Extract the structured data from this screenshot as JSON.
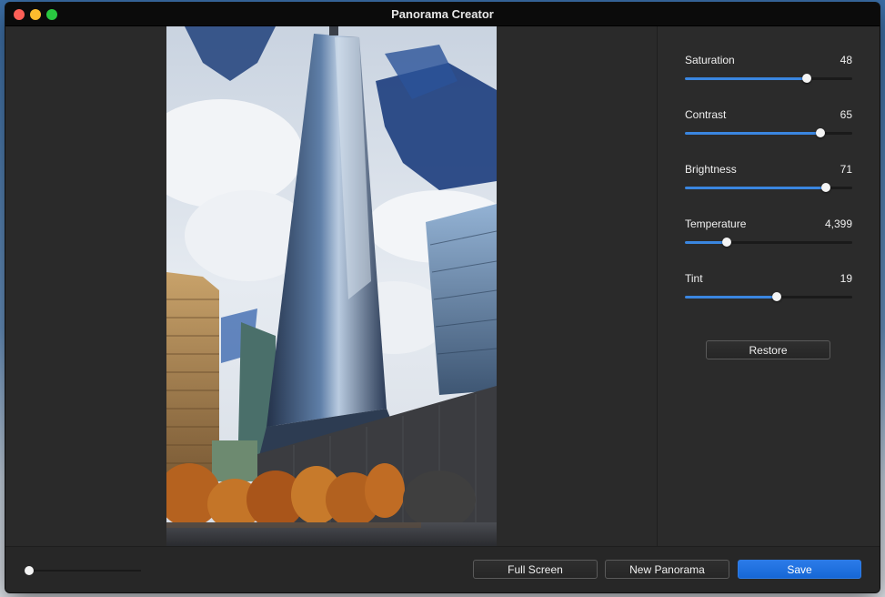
{
  "window": {
    "title": "Panorama Creator"
  },
  "adjustments": [
    {
      "label": "Saturation",
      "value": "48",
      "fraction": 0.73
    },
    {
      "label": "Contrast",
      "value": "65",
      "fraction": 0.81
    },
    {
      "label": "Brightness",
      "value": "71",
      "fraction": 0.84
    },
    {
      "label": "Temperature",
      "value": "4,399",
      "fraction": 0.25
    },
    {
      "label": "Tint",
      "value": "19",
      "fraction": 0.55
    }
  ],
  "panel": {
    "restore_label": "Restore"
  },
  "bottom": {
    "zoom_fraction": 0.0,
    "fullscreen_label": "Full Screen",
    "new_panorama_label": "New Panorama",
    "save_label": "Save"
  },
  "colors": {
    "accent": "#3a86e0",
    "save_button": "#1667d6"
  }
}
